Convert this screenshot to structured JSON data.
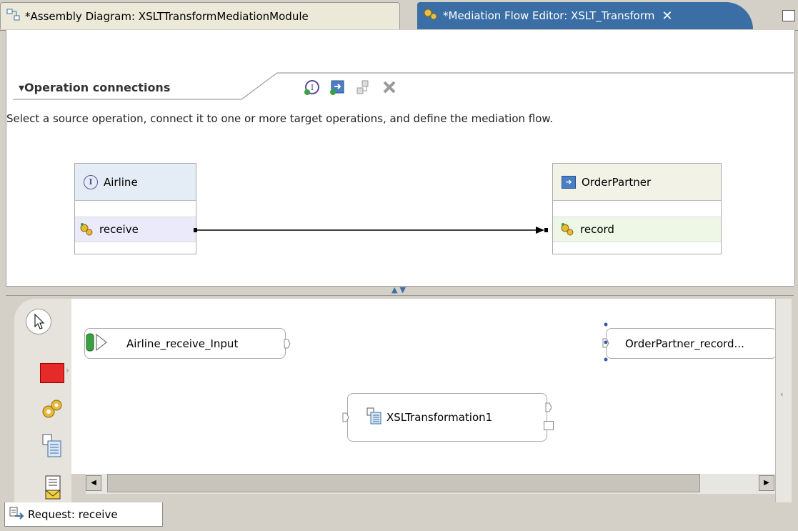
{
  "tabs": {
    "assembly_title": "*Assembly Diagram: XSLTTransformMediationModule",
    "mediation_title": "*Mediation Flow Editor: XSLT_Transform",
    "close_glyph": "✕"
  },
  "section": {
    "title": "▾Operation connections",
    "instructions": "Select a source operation, connect it to one or more target operations, and define the mediation flow."
  },
  "source_interface": {
    "name": "Airline",
    "operation": "receive"
  },
  "target_reference": {
    "name": "OrderPartner",
    "operation": "record"
  },
  "flow": {
    "input_node": "Airline_receive_Input",
    "callout_node": "OrderPartner_record...",
    "xslt_node": "XSLTransformation1"
  },
  "bottom_tab": {
    "label": "Request: receive"
  },
  "icons": {
    "toolbar": [
      "add-interface-icon",
      "add-reference-icon",
      "connect-icon",
      "delete-icon"
    ],
    "palette": [
      "select-pointer-icon",
      "stop-icon",
      "gears-icon",
      "xslt-icon",
      "message-icon"
    ]
  },
  "colors": {
    "active_tab": "#3a6ea5",
    "palette_stop": "#e62a2a",
    "connection_line": "#000000"
  }
}
